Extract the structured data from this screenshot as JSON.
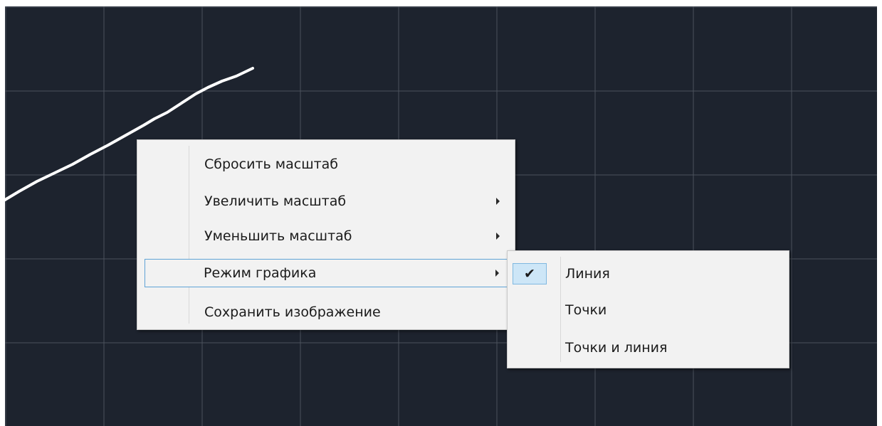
{
  "plot": {
    "background": "#1d232e",
    "grid_color": "#4a515c",
    "line_color": "#ffffff"
  },
  "context_menu": {
    "items": [
      {
        "label": "Сбросить масштаб",
        "has_submenu": false
      },
      {
        "label": "Увеличить масштаб",
        "has_submenu": true
      },
      {
        "label": "Уменьшить масштаб",
        "has_submenu": true
      },
      {
        "label": "Режим графика",
        "has_submenu": true,
        "highlighted": true
      },
      {
        "label": "Сохранить изображение",
        "has_submenu": false
      }
    ]
  },
  "submenu": {
    "items": [
      {
        "label": "Линия",
        "checked": true
      },
      {
        "label": "Точки",
        "checked": false
      },
      {
        "label": "Точки и линия",
        "checked": false
      }
    ],
    "check_glyph": "✔"
  }
}
